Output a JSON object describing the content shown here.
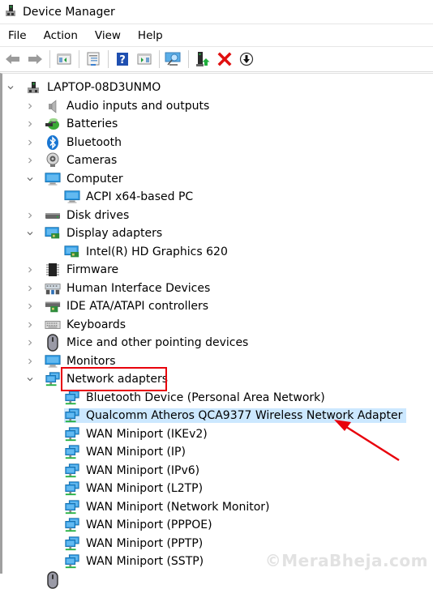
{
  "window": {
    "title": "Device Manager",
    "icon": "device-manager-icon"
  },
  "menu": [
    "File",
    "Action",
    "View",
    "Help"
  ],
  "toolbar": [
    {
      "name": "back-button",
      "icon": "arrow-left-icon"
    },
    {
      "name": "forward-button",
      "icon": "arrow-right-icon"
    },
    {
      "sep": true
    },
    {
      "name": "show-hide-console-tree-button",
      "icon": "console-tree-icon"
    },
    {
      "sep": true
    },
    {
      "name": "properties-button",
      "icon": "properties-icon"
    },
    {
      "sep": true
    },
    {
      "name": "help-button",
      "icon": "help-icon"
    },
    {
      "name": "show-action-pane-button",
      "icon": "action-pane-icon"
    },
    {
      "sep": true
    },
    {
      "name": "scan-hardware-changes-button",
      "icon": "scan-monitor-icon"
    },
    {
      "sep": true
    },
    {
      "name": "update-driver-button",
      "icon": "update-driver-icon"
    },
    {
      "name": "uninstall-device-button",
      "icon": "red-x-icon"
    },
    {
      "name": "disable-device-button",
      "icon": "down-arrow-circle-icon"
    }
  ],
  "tree": {
    "root": "LAPTOP-08D3UNMO",
    "categories": [
      {
        "label": "Audio inputs and outputs",
        "icon": "speaker-icon",
        "expanded": false,
        "children": []
      },
      {
        "label": "Batteries",
        "icon": "battery-icon",
        "expanded": false,
        "children": []
      },
      {
        "label": "Bluetooth",
        "icon": "bluetooth-icon",
        "expanded": false,
        "children": []
      },
      {
        "label": "Cameras",
        "icon": "camera-icon",
        "expanded": false,
        "children": []
      },
      {
        "label": "Computer",
        "icon": "monitor-icon",
        "expanded": true,
        "children": [
          "ACPI x64-based PC"
        ]
      },
      {
        "label": "Disk drives",
        "icon": "disk-drive-icon",
        "expanded": false,
        "children": []
      },
      {
        "label": "Display adapters",
        "icon": "display-adapter-icon",
        "expanded": true,
        "children": [
          "Intel(R) HD Graphics 620"
        ]
      },
      {
        "label": "Firmware",
        "icon": "chip-icon",
        "expanded": false,
        "children": []
      },
      {
        "label": "Human Interface Devices",
        "icon": "hid-icon",
        "expanded": false,
        "children": []
      },
      {
        "label": "IDE ATA/ATAPI controllers",
        "icon": "ide-controller-icon",
        "expanded": false,
        "children": []
      },
      {
        "label": "Keyboards",
        "icon": "keyboard-icon",
        "expanded": false,
        "children": []
      },
      {
        "label": "Mice and other pointing devices",
        "icon": "mouse-icon",
        "expanded": false,
        "children": []
      },
      {
        "label": "Monitors",
        "icon": "monitor-icon",
        "expanded": false,
        "children": []
      },
      {
        "label": "Network adapters",
        "icon": "network-adapter-icon",
        "expanded": true,
        "highlighted": true,
        "children": [
          "Bluetooth Device (Personal Area Network)",
          "Qualcomm Atheros QCA9377 Wireless Network Adapter",
          "WAN Miniport (IKEv2)",
          "WAN Miniport (IP)",
          "WAN Miniport (IPv6)",
          "WAN Miniport (L2TP)",
          "WAN Miniport (Network Monitor)",
          "WAN Miniport (PPPOE)",
          "WAN Miniport (PPTP)",
          "WAN Miniport (SSTP)"
        ]
      }
    ],
    "selected": "Qualcomm Atheros QCA9377 Wireless Network Adapter"
  },
  "annotation": {
    "box_target": "Network adapters",
    "arrow_target": "Qualcomm Atheros QCA9377 Wireless Network Adapter",
    "color": "#e8000b"
  },
  "watermark": "©MeraBheja.com"
}
